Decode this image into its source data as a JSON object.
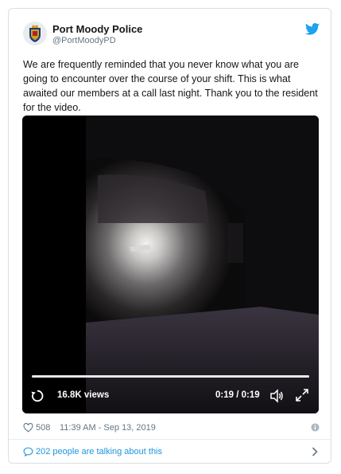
{
  "account": {
    "name": "Port Moody Police",
    "handle": "@PortMoodyPD",
    "avatar_icon": "police-crest-icon",
    "platform_icon": "twitter-bird-icon"
  },
  "tweet": {
    "text": "We are frequently reminded that you never know what you are going to encounter over the course of your shift. This is what awaited our members at a call last night. Thank you to the resident for the video."
  },
  "video": {
    "views": "16.8K views",
    "time": "0:19 / 0:19",
    "progress": 1.0
  },
  "meta": {
    "likes": "508",
    "datetime": "11:39 AM - Sep 13, 2019"
  },
  "conversation": {
    "label": "202 people are talking about this"
  },
  "colors": {
    "text": "#14171a",
    "secondary": "#657786",
    "link": "#1b95e0",
    "twitter_blue": "#1da1f2"
  }
}
